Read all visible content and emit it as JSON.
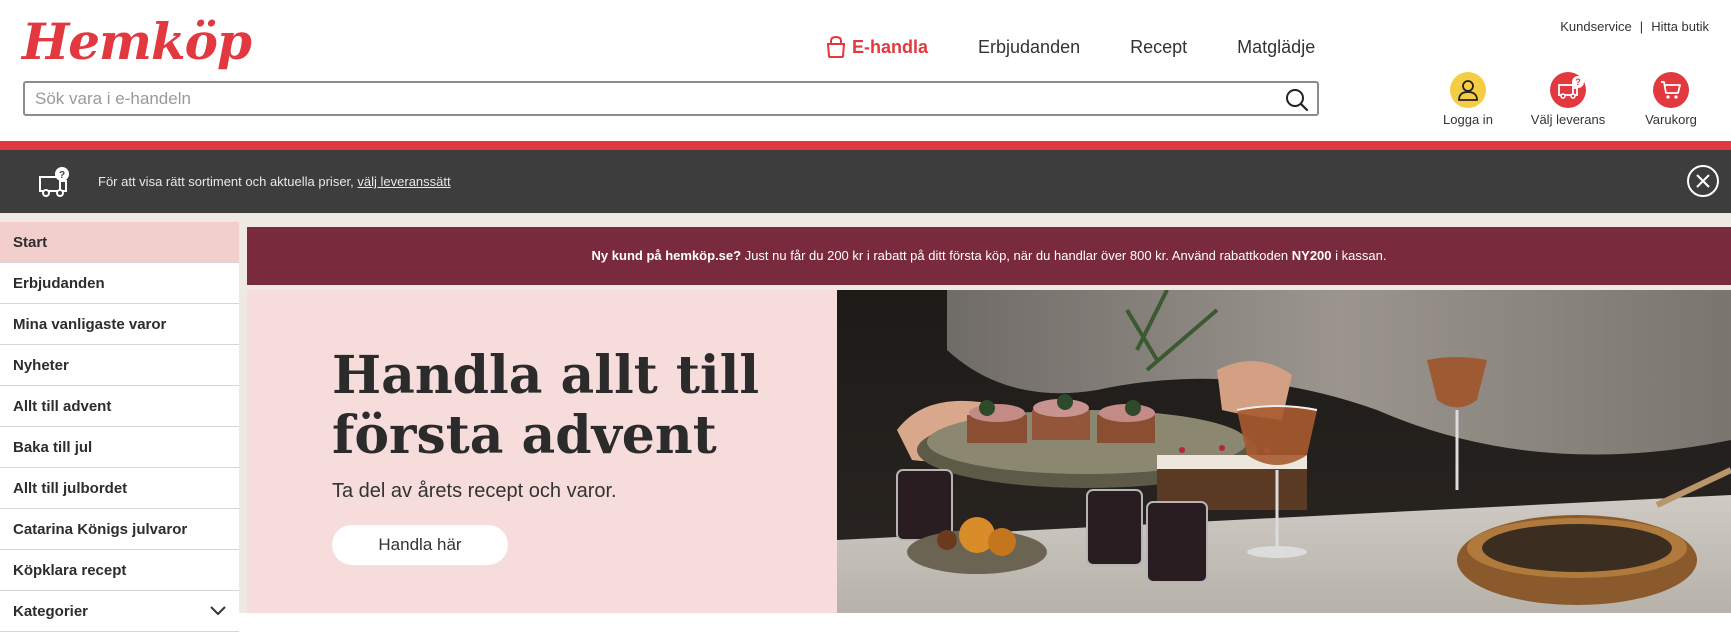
{
  "header": {
    "logo": "Hemköp",
    "top_links": {
      "kundservice": "Kundservice",
      "separator": "|",
      "hitta_butik": "Hitta butik"
    },
    "nav": {
      "ehandla": "E-handla",
      "erbjudanden": "Erbjudanden",
      "recept": "Recept",
      "matgladje": "Matglädje"
    },
    "search": {
      "placeholder": "Sök vara i e-handeln",
      "value": ""
    },
    "actions": {
      "login": "Logga in",
      "delivery": "Välj leverans",
      "cart": "Varukorg"
    }
  },
  "info_bar": {
    "text": "För att visa rätt sortiment och aktuella priser,",
    "link": "välj leveranssätt"
  },
  "sidebar": {
    "items": [
      {
        "label": "Start",
        "active": true
      },
      {
        "label": "Erbjudanden"
      },
      {
        "label": "Mina vanligaste varor"
      },
      {
        "label": "Nyheter"
      },
      {
        "label": "Allt till advent"
      },
      {
        "label": "Baka till jul"
      },
      {
        "label": "Allt till julbordet"
      },
      {
        "label": "Catarina Königs julvaror"
      },
      {
        "label": "Köpklara recept"
      },
      {
        "label": "Kategorier"
      }
    ]
  },
  "promo": {
    "lead": "Ny kund på hemköp.se?",
    "text": " Just nu får du 200 kr i rabatt på ditt första köp, när du handlar över 800 kr. Använd rabattkoden ",
    "code": "NY200",
    "tail": " i kassan."
  },
  "hero": {
    "title": "Handla allt till första advent",
    "subtitle": "Ta del av årets recept och varor.",
    "button": "Handla här"
  },
  "colors": {
    "brand_red": "#e2383f",
    "promo_bg": "#7a2a3d",
    "hero_pink": "#f6dcdb",
    "login_yellow": "#f5cd45"
  }
}
